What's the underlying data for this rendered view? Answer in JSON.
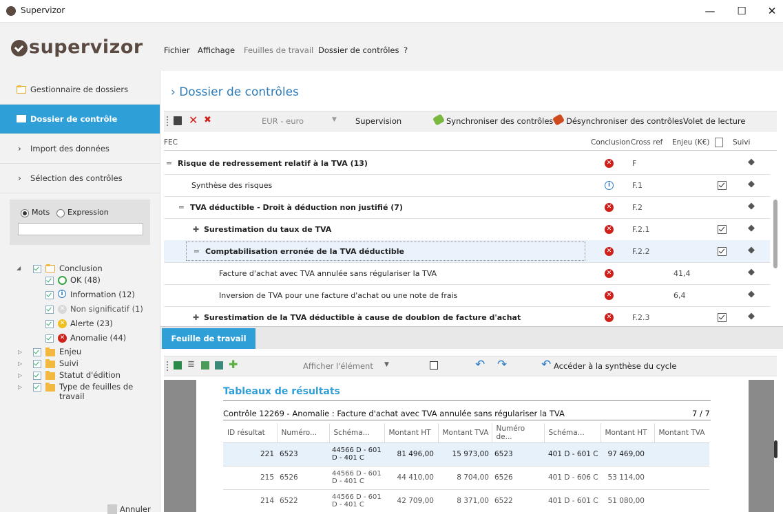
{
  "window": {
    "title": "Supervizor",
    "controls": [
      "—",
      "☐",
      "✕"
    ]
  },
  "logo": "supervizor",
  "menu": [
    "Fichier",
    "Affichage",
    "Feuilles de travail",
    "Dossier de contrôles",
    "?"
  ],
  "sidebar": {
    "items": [
      {
        "label": "Gestionnaire de dossiers"
      },
      {
        "label": "Dossier de contrôle"
      },
      {
        "label": "Import des données"
      },
      {
        "label": "Sélection des contrôles"
      }
    ],
    "search": {
      "opt1": "Mots",
      "opt2": "Expression",
      "value": ""
    },
    "tree": {
      "conclusion": "Conclusion",
      "children": [
        "OK (48)",
        "Information (12)",
        "Non significatif (1)",
        "Alerte (23)",
        "Anomalie (44)"
      ],
      "others": [
        "Enjeu",
        "Suivi",
        "Statut d'édition",
        "Type de feuilles de travail"
      ]
    },
    "cancel": "Annuler"
  },
  "main": {
    "title": "› Dossier de contrôles",
    "currency": "EUR - euro",
    "supervision": "Supervision",
    "sync": "Synchroniser des contrôles",
    "desync": "Désynchroniser des contrôles",
    "volet": "Volet de lecture",
    "columns": {
      "fec": "FEC",
      "conclusion": "Conclusion",
      "crossref": "Cross ref",
      "enjeu": "Enjeu (K€)",
      "suivi": "Suivi"
    },
    "rows": [
      {
        "label": "Risque de redressement relatif à la TVA (13)",
        "ref": "F",
        "enjeu": ""
      },
      {
        "label": "Synthèse des risques",
        "ref": "F.1",
        "enjeu": ""
      },
      {
        "label": "TVA déductible - Droit à déduction non justifié (7)",
        "ref": "F.2",
        "enjeu": ""
      },
      {
        "label": "Surestimation du taux de TVA",
        "ref": "F.2.1",
        "enjeu": ""
      },
      {
        "label": "Comptabilisation erronée de la TVA déductible",
        "ref": "F.2.2",
        "enjeu": ""
      },
      {
        "label": "Facture d'achat avec TVA annulée sans régulariser la TVA",
        "ref": "",
        "enjeu": "41,4"
      },
      {
        "label": "Inversion de TVA pour une facture d'achat ou une note de frais",
        "ref": "",
        "enjeu": "6,4"
      },
      {
        "label": "Surestimation de la TVA déductible à cause de doublon de facture d'achat",
        "ref": "F.2.3",
        "enjeu": ""
      }
    ]
  },
  "worksheet": {
    "tab": "Feuille de travail",
    "afficher": "Afficher l'élément",
    "acceder": "Accéder à la synthèse du cycle",
    "tables_title": "Tableaux de résultats",
    "control_title": "Contrôle 12269 - Anomalie : Facture d'achat avec TVA annulée sans régulariser la TVA",
    "pager": "7 / 7",
    "headers": [
      "ID résultat",
      "Numéro...",
      "Schéma...",
      "Montant HT",
      "Montant TVA",
      "Numéro de...",
      "Schéma...",
      "Montant HT",
      "Montant TVA"
    ],
    "rows": [
      [
        "221",
        "6523",
        "44566 D - 601 D - 401 C",
        "81 496,00",
        "15 973,00",
        "6523",
        "401 D - 601 C",
        "97 469,00",
        ""
      ],
      [
        "215",
        "6526",
        "44566 D - 601 D - 401 C",
        "44 410,00",
        "8 704,00",
        "6526",
        "401 D - 606 C",
        "53 114,00",
        ""
      ],
      [
        "214",
        "6522",
        "44566 D - 601 D - 401 C",
        "42 709,00",
        "8 371,00",
        "6522",
        "401 D - 601 C",
        "51 080,00",
        ""
      ]
    ]
  }
}
